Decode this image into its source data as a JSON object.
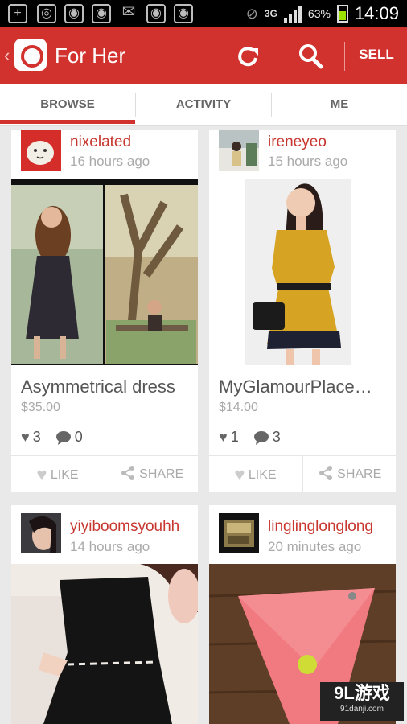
{
  "statusbar": {
    "network": "3G",
    "battery": "63%",
    "time": "14:09"
  },
  "appbar": {
    "title": "For Her",
    "sell": "SELL"
  },
  "tabs": [
    "BROWSE",
    "ACTIVITY",
    "ME"
  ],
  "listings": [
    {
      "user": "nixelated",
      "time": "16 hours ago",
      "title": "Asymmetrical dress",
      "price": "$35.00",
      "likes": "3",
      "comments": "0"
    },
    {
      "user": "ireneyeo",
      "time": "15 hours ago",
      "title": "MyGlamourPlace…",
      "price": "$14.00",
      "likes": "1",
      "comments": "3"
    },
    {
      "user": "yiyiboomsyouhh",
      "time": "14 hours ago"
    },
    {
      "user": "linglinglonglong",
      "time": "20 minutes ago"
    }
  ],
  "actions": {
    "like": "LIKE",
    "share": "SHARE"
  },
  "watermark": {
    "main": "9L游戏",
    "sub": "91danji.com"
  },
  "colors": {
    "brand_red": "#d2322d",
    "username": "#c8372f"
  }
}
